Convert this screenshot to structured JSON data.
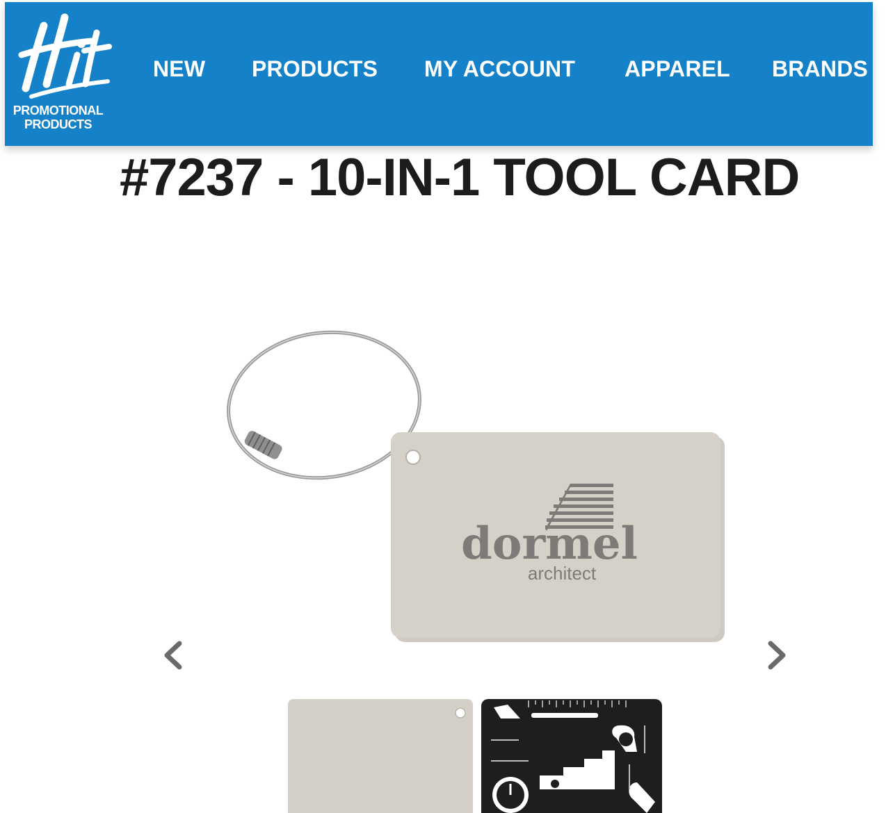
{
  "logo": {
    "script": "Hit",
    "line1": "PROMOTIONAL",
    "line2": "PRODUCTS"
  },
  "nav": {
    "items": [
      {
        "label": "NEW"
      },
      {
        "label": "PRODUCTS"
      },
      {
        "label": "MY ACCOUNT"
      },
      {
        "label": "APPAREL"
      },
      {
        "label": "BRANDS"
      }
    ]
  },
  "product": {
    "title": "#7237 - 10-IN-1 TOOL CARD"
  },
  "image": {
    "brand_text": "dormel",
    "brand_sub": "architect"
  },
  "carousel": {
    "prev_icon": "chevron-left-icon",
    "next_icon": "chevron-right-icon"
  },
  "colors": {
    "header": "#1481c8",
    "card": "#d5d0c7",
    "tool": "#1e1e1e",
    "arrow": "#6a6a6a"
  }
}
